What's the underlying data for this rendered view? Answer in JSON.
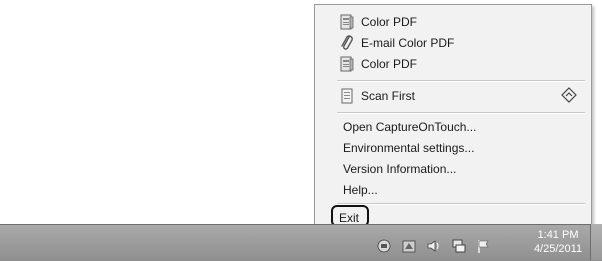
{
  "menu": {
    "items": [
      {
        "label": "Color PDF",
        "icon": "document-scanner-icon"
      },
      {
        "label": "E-mail Color PDF",
        "icon": "paperclip-icon"
      },
      {
        "label": "Color PDF",
        "icon": "document-scanner-icon"
      }
    ],
    "scan_first": {
      "label": "Scan First",
      "icon": "page-icon",
      "shortcut_icon": "diamond-arrow-icon"
    },
    "commands": [
      {
        "label": "Open CaptureOnTouch..."
      },
      {
        "label": "Environmental settings..."
      },
      {
        "label": "Version Information..."
      },
      {
        "label": "Help..."
      }
    ],
    "exit": {
      "label": "Exit"
    }
  },
  "taskbar": {
    "tray_icons": [
      "network-icon",
      "capture-on-touch-icon",
      "speaker-icon",
      "network-monitor-icon",
      "action-center-flag-icon"
    ],
    "clock": {
      "time": "1:41 PM",
      "date": "4/25/2011"
    }
  }
}
